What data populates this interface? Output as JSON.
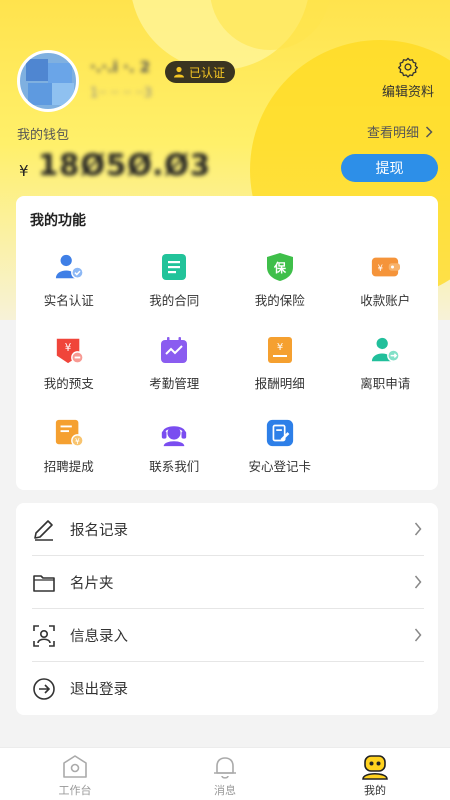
{
  "profile": {
    "name": "·.·.i ·. 2",
    "phone": "1·· ·· ·· ··3",
    "verified_badge": "已认证",
    "edit_label": "编辑资料"
  },
  "wallet": {
    "title": "我的钱包",
    "detail_link": "查看明细",
    "currency_symbol": "¥",
    "amount": "18Ø5Ø.Ø3",
    "withdraw_label": "提现"
  },
  "functions": {
    "title": "我的功能",
    "items": [
      {
        "label": "实名认证",
        "icon": "id-verify-icon",
        "color": "#3f7fe6"
      },
      {
        "label": "我的合同",
        "icon": "contract-icon",
        "color": "#22c39a"
      },
      {
        "label": "我的保险",
        "icon": "insurance-icon",
        "color": "#3fbf4a"
      },
      {
        "label": "收款账户",
        "icon": "wallet-account-icon",
        "color": "#f5943a"
      },
      {
        "label": "我的预支",
        "icon": "advance-icon",
        "color": "#f0453a"
      },
      {
        "label": "考勤管理",
        "icon": "attendance-icon",
        "color": "#8a5cf0"
      },
      {
        "label": "报酬明细",
        "icon": "salary-detail-icon",
        "color": "#f5a030"
      },
      {
        "label": "离职申请",
        "icon": "resign-icon",
        "color": "#21bf9b"
      },
      {
        "label": "招聘提成",
        "icon": "recruit-commission-icon",
        "color": "#f5a030"
      },
      {
        "label": "联系我们",
        "icon": "customer-service-icon",
        "color": "#7a4df0"
      },
      {
        "label": "安心登记卡",
        "icon": "register-card-icon",
        "color": "#2d7fe8"
      }
    ]
  },
  "menu": {
    "items": [
      {
        "label": "报名记录",
        "icon": "pen-icon",
        "chevron": true
      },
      {
        "label": "名片夹",
        "icon": "folder-icon",
        "chevron": true
      },
      {
        "label": "信息录入",
        "icon": "scan-face-icon",
        "chevron": true
      },
      {
        "label": "退出登录",
        "icon": "logout-icon",
        "chevron": false
      }
    ]
  },
  "tabbar": {
    "tabs": [
      {
        "label": "工作台",
        "icon": "workbench-icon",
        "active": false
      },
      {
        "label": "消息",
        "icon": "bell-icon",
        "active": false
      },
      {
        "label": "我的",
        "icon": "profile-robot-icon",
        "active": true
      }
    ]
  },
  "colors": {
    "accent_blue": "#2d8fe8",
    "header_yellow": "#ffe34d",
    "badge_bg": "#3a3420",
    "badge_text": "#f5c623"
  }
}
